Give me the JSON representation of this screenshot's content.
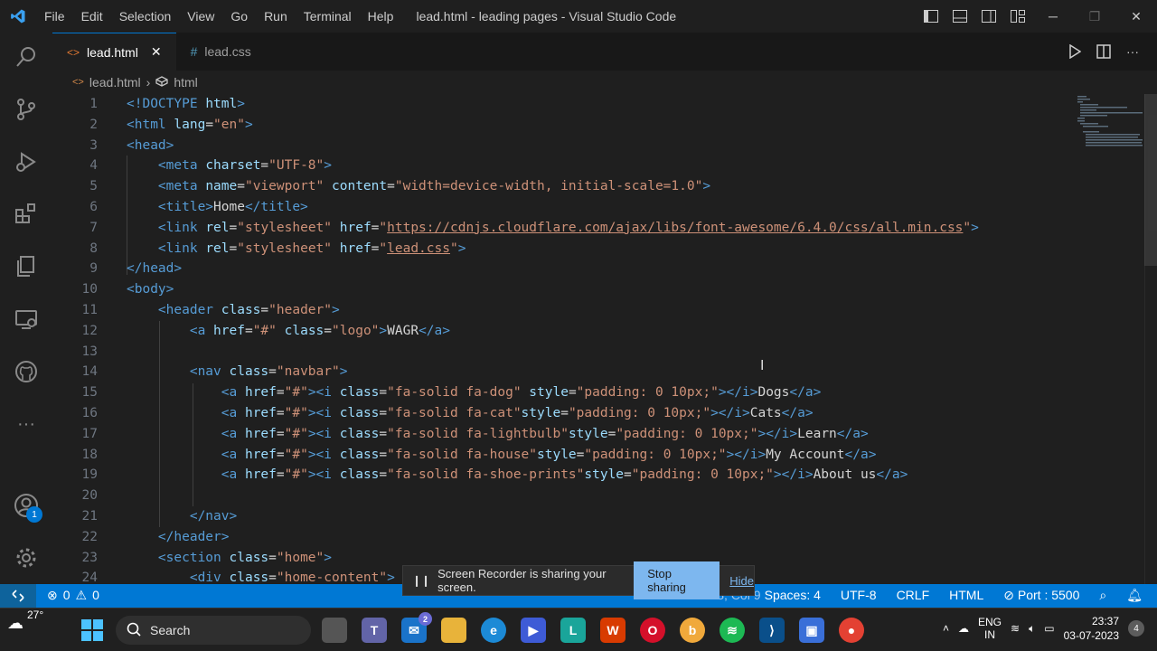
{
  "window": {
    "title": "lead.html - leading pages - Visual Studio Code",
    "menu": [
      "File",
      "Edit",
      "Selection",
      "View",
      "Go",
      "Run",
      "Terminal",
      "Help"
    ]
  },
  "tabs": [
    {
      "label": "lead.html",
      "icon": "html-file-icon",
      "active": true
    },
    {
      "label": "lead.css",
      "icon": "css-file-icon",
      "active": false
    }
  ],
  "breadcrumb": {
    "file": "lead.html",
    "symbol": "html"
  },
  "editor": {
    "line_numbers": [
      "1",
      "2",
      "3",
      "4",
      "5",
      "6",
      "7",
      "8",
      "9",
      "10",
      "11",
      "12",
      "13",
      "14",
      "15",
      "16",
      "17",
      "18",
      "19",
      "20",
      "21",
      "22",
      "23",
      "24"
    ],
    "lines": [
      [
        [
          "t",
          "<!DOCTYPE "
        ],
        [
          "a",
          "html"
        ],
        [
          "t",
          ">"
        ]
      ],
      [
        [
          "t",
          "<html "
        ],
        [
          "a",
          "lang"
        ],
        [
          "x",
          "="
        ],
        [
          "s",
          "\"en\""
        ],
        [
          "t",
          ">"
        ]
      ],
      [
        [
          "t",
          "<head>"
        ]
      ],
      [
        [
          "x",
          "    "
        ],
        [
          "t",
          "<meta "
        ],
        [
          "a",
          "charset"
        ],
        [
          "x",
          "="
        ],
        [
          "s",
          "\"UTF-8\""
        ],
        [
          "t",
          ">"
        ]
      ],
      [
        [
          "x",
          "    "
        ],
        [
          "t",
          "<meta "
        ],
        [
          "a",
          "name"
        ],
        [
          "x",
          "="
        ],
        [
          "s",
          "\"viewport\""
        ],
        [
          "x",
          " "
        ],
        [
          "a",
          "content"
        ],
        [
          "x",
          "="
        ],
        [
          "s",
          "\"width=device-width, initial-scale=1.0\""
        ],
        [
          "t",
          ">"
        ]
      ],
      [
        [
          "x",
          "    "
        ],
        [
          "t",
          "<title>"
        ],
        [
          "x",
          "Home"
        ],
        [
          "t",
          "</title>"
        ]
      ],
      [
        [
          "x",
          "    "
        ],
        [
          "t",
          "<link "
        ],
        [
          "a",
          "rel"
        ],
        [
          "x",
          "="
        ],
        [
          "s",
          "\"stylesheet\""
        ],
        [
          "x",
          " "
        ],
        [
          "a",
          "href"
        ],
        [
          "x",
          "="
        ],
        [
          "s",
          "\""
        ],
        [
          "u",
          "https://cdnjs.cloudflare.com/ajax/libs/font-awesome/6.4.0/css/all.min.css"
        ],
        [
          "s",
          "\""
        ],
        [
          "t",
          ">"
        ]
      ],
      [
        [
          "x",
          "    "
        ],
        [
          "t",
          "<link "
        ],
        [
          "a",
          "rel"
        ],
        [
          "x",
          "="
        ],
        [
          "s",
          "\"stylesheet\""
        ],
        [
          "x",
          " "
        ],
        [
          "a",
          "href"
        ],
        [
          "x",
          "="
        ],
        [
          "s",
          "\""
        ],
        [
          "u",
          "lead.css"
        ],
        [
          "s",
          "\""
        ],
        [
          "t",
          ">"
        ]
      ],
      [
        [
          "t",
          "</head>"
        ]
      ],
      [
        [
          "t",
          "<body>"
        ]
      ],
      [
        [
          "x",
          "    "
        ],
        [
          "t",
          "<header "
        ],
        [
          "a",
          "class"
        ],
        [
          "x",
          "="
        ],
        [
          "s",
          "\"header\""
        ],
        [
          "t",
          ">"
        ]
      ],
      [
        [
          "x",
          "        "
        ],
        [
          "t",
          "<a "
        ],
        [
          "a",
          "href"
        ],
        [
          "x",
          "="
        ],
        [
          "s",
          "\"#\""
        ],
        [
          "x",
          " "
        ],
        [
          "a",
          "class"
        ],
        [
          "x",
          "="
        ],
        [
          "s",
          "\"logo\""
        ],
        [
          "t",
          ">"
        ],
        [
          "x",
          "WAGR"
        ],
        [
          "t",
          "</a>"
        ]
      ],
      [
        [
          "x",
          ""
        ]
      ],
      [
        [
          "x",
          "        "
        ],
        [
          "t",
          "<nav "
        ],
        [
          "a",
          "class"
        ],
        [
          "x",
          "="
        ],
        [
          "s",
          "\"navbar\""
        ],
        [
          "t",
          ">"
        ]
      ],
      [
        [
          "x",
          "            "
        ],
        [
          "t",
          "<a "
        ],
        [
          "a",
          "href"
        ],
        [
          "x",
          "="
        ],
        [
          "s",
          "\"#\""
        ],
        [
          "t",
          "><i "
        ],
        [
          "a",
          "class"
        ],
        [
          "x",
          "="
        ],
        [
          "s",
          "\"fa-solid fa-dog\""
        ],
        [
          "x",
          " "
        ],
        [
          "a",
          "style"
        ],
        [
          "x",
          "="
        ],
        [
          "s",
          "\"padding: 0 10px;\""
        ],
        [
          "t",
          "></i>"
        ],
        [
          "x",
          "Dogs"
        ],
        [
          "t",
          "</a>"
        ]
      ],
      [
        [
          "x",
          "            "
        ],
        [
          "t",
          "<a "
        ],
        [
          "a",
          "href"
        ],
        [
          "x",
          "="
        ],
        [
          "s",
          "\"#\""
        ],
        [
          "t",
          "><i "
        ],
        [
          "a",
          "class"
        ],
        [
          "x",
          "="
        ],
        [
          "s",
          "\"fa-solid fa-cat\""
        ],
        [
          "a",
          "style"
        ],
        [
          "x",
          "="
        ],
        [
          "s",
          "\"padding: 0 10px;\""
        ],
        [
          "t",
          "></i>"
        ],
        [
          "x",
          "Cats"
        ],
        [
          "t",
          "</a>"
        ]
      ],
      [
        [
          "x",
          "            "
        ],
        [
          "t",
          "<a "
        ],
        [
          "a",
          "href"
        ],
        [
          "x",
          "="
        ],
        [
          "s",
          "\"#\""
        ],
        [
          "t",
          "><i "
        ],
        [
          "a",
          "class"
        ],
        [
          "x",
          "="
        ],
        [
          "s",
          "\"fa-solid fa-lightbulb\""
        ],
        [
          "a",
          "style"
        ],
        [
          "x",
          "="
        ],
        [
          "s",
          "\"padding: 0 10px;\""
        ],
        [
          "t",
          "></i>"
        ],
        [
          "x",
          "Learn"
        ],
        [
          "t",
          "</a>"
        ]
      ],
      [
        [
          "x",
          "            "
        ],
        [
          "t",
          "<a "
        ],
        [
          "a",
          "href"
        ],
        [
          "x",
          "="
        ],
        [
          "s",
          "\"#\""
        ],
        [
          "t",
          "><i "
        ],
        [
          "a",
          "class"
        ],
        [
          "x",
          "="
        ],
        [
          "s",
          "\"fa-solid fa-house\""
        ],
        [
          "a",
          "style"
        ],
        [
          "x",
          "="
        ],
        [
          "s",
          "\"padding: 0 10px;\""
        ],
        [
          "t",
          "></i>"
        ],
        [
          "x",
          "My Account"
        ],
        [
          "t",
          "</a>"
        ]
      ],
      [
        [
          "x",
          "            "
        ],
        [
          "t",
          "<a "
        ],
        [
          "a",
          "href"
        ],
        [
          "x",
          "="
        ],
        [
          "s",
          "\"#\""
        ],
        [
          "t",
          "><i "
        ],
        [
          "a",
          "class"
        ],
        [
          "x",
          "="
        ],
        [
          "s",
          "\"fa-solid fa-shoe-prints\""
        ],
        [
          "a",
          "style"
        ],
        [
          "x",
          "="
        ],
        [
          "s",
          "\"padding: 0 10px;\""
        ],
        [
          "t",
          "></i>"
        ],
        [
          "x",
          "About us"
        ],
        [
          "t",
          "</a>"
        ]
      ],
      [
        [
          "x",
          ""
        ]
      ],
      [
        [
          "x",
          "        "
        ],
        [
          "t",
          "</nav>"
        ]
      ],
      [
        [
          "x",
          "    "
        ],
        [
          "t",
          "</header>"
        ]
      ],
      [
        [
          "x",
          "    "
        ],
        [
          "t",
          "<section "
        ],
        [
          "a",
          "class"
        ],
        [
          "x",
          "="
        ],
        [
          "s",
          "\"home\""
        ],
        [
          "t",
          ">"
        ]
      ],
      [
        [
          "x",
          "        "
        ],
        [
          "t",
          "<div "
        ],
        [
          "a",
          "class"
        ],
        [
          "x",
          "="
        ],
        [
          "s",
          "\"home-content\""
        ],
        [
          "t",
          ">"
        ]
      ]
    ]
  },
  "toast": {
    "message": "Screen Recorder is sharing your screen.",
    "stop_label": "Stop sharing",
    "hide_label": "Hide"
  },
  "status": {
    "errors": "0",
    "warnings": "0",
    "position": "Ln 13, Col 9",
    "spaces": "Spaces: 4",
    "encoding": "UTF-8",
    "eol": "CRLF",
    "language": "HTML",
    "port": "Port : 5500"
  },
  "activity": {
    "accounts_badge": "1"
  },
  "taskbar": {
    "temperature": "27°",
    "search_label": "Search",
    "mail_badge": "2",
    "lang_top": "ENG",
    "lang_bottom": "IN",
    "time": "23:37",
    "date": "03-07-2023",
    "notifications": "4"
  },
  "colors": {
    "accent": "#0078d4",
    "tag": "#569cd6",
    "attr": "#9cdcfe",
    "string": "#ce9178"
  }
}
